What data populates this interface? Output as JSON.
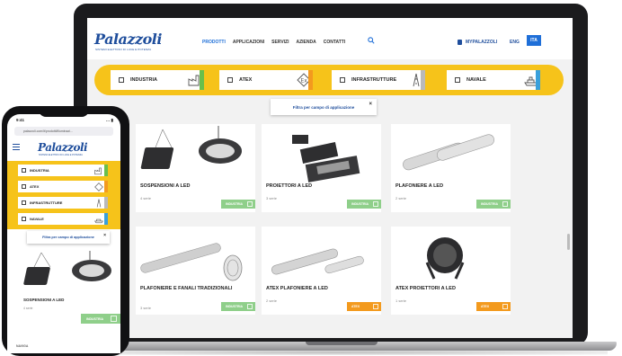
{
  "colors": {
    "brand_blue": "#1f4e9c",
    "accent_blue": "#1f6fd8",
    "band_yellow": "#f6c31a",
    "industria_green": "#6abf4b",
    "atex_orange": "#f39a1e",
    "infra_gray": "#b9b9b9",
    "navale_blue": "#3aa0db"
  },
  "laptop": {
    "logo": "Palazzoli",
    "logo_sub": "SISTEMI ELETTRICI DI LUCE E POTENZA",
    "nav": [
      "PRODOTTI",
      "APPLICAZIONI",
      "SERVIZI",
      "AZIENDA",
      "CONTATTI"
    ],
    "search_icon": "search-icon",
    "account": "MYPALAZZOLI",
    "lang_eng": "ENG",
    "lang_ita": "ITA",
    "filters": [
      {
        "label": "INDUSTRIA",
        "icon": "factory-icon"
      },
      {
        "label": "ATEX",
        "icon": "ex-warning-icon"
      },
      {
        "label": "INFRASTRUTTURE",
        "icon": "road-icon"
      },
      {
        "label": "NAVALE",
        "icon": "ship-icon"
      }
    ],
    "tooltip": "Filtra per campo di applicazione",
    "tooltip_close": "×",
    "products": [
      {
        "title": "SOSPENSIONI A LED",
        "series": "4 serie",
        "tag": "INDUSTRIA"
      },
      {
        "title": "PROIETTORI A LED",
        "series": "3 serie",
        "tag": "INDUSTRIA"
      },
      {
        "title": "PLAFONIERE A LED",
        "series": "2 serie",
        "tag": "INDUSTRIA"
      },
      {
        "title": "PLAFONIERE E FANALI TRADIZIONALI",
        "series": "3 serie",
        "tag": "INDUSTRIA"
      },
      {
        "title": "ATEX PLAFONIERE A LED",
        "series": "2 serie",
        "tag": "ATEX"
      },
      {
        "title": "ATEX PROIETTORI A LED",
        "series": "1 serie",
        "tag": "ATEX"
      }
    ]
  },
  "phone": {
    "time": "9:41",
    "signal": "… ▮",
    "url": "palazzoli.com/it/prodotti/illuminazi...",
    "logo": "Palazzoli",
    "logo_sub": "SISTEMI ELETTRICI DI LUCE E POTENZA",
    "filters": [
      "INDUSTRIA",
      "ATEX",
      "INFRASTRUTTURE",
      "NAVALE"
    ],
    "tooltip": "Filtra per campo di applicazione",
    "tooltip_close": "×",
    "product": {
      "title": "SOSPENSIONI A LED",
      "series": "4 serie",
      "tag": "INDUSTRIA"
    },
    "bottom_label": "NAVIGA"
  }
}
